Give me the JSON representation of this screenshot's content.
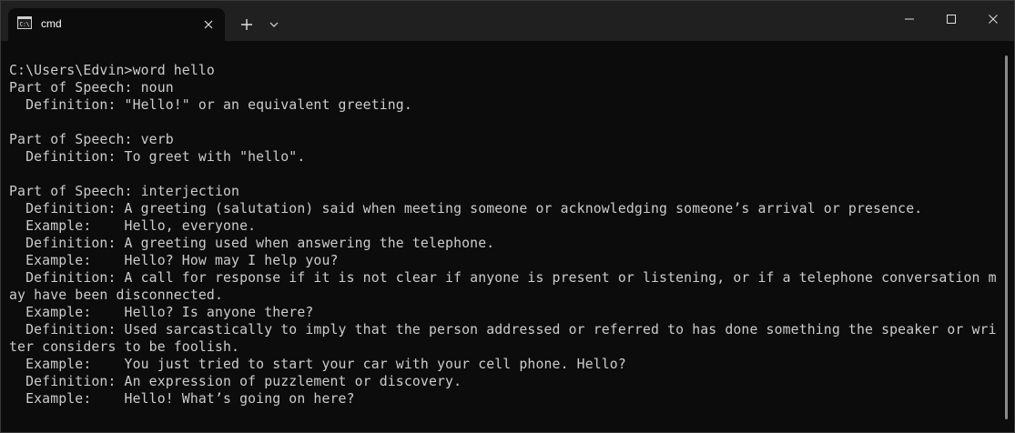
{
  "window": {
    "tab_title": "cmd",
    "colors": {
      "titlebar": "#202020",
      "terminal_bg": "#0c0c0c",
      "terminal_fg": "#cccccc",
      "scrollbar_thumb": "#8a8a8a"
    }
  },
  "icons": {
    "tab_icon": "cmd-icon",
    "tab_close": "close-icon",
    "new_tab": "plus-icon",
    "dropdown": "chevron-down-icon",
    "minimize": "minimize-icon",
    "maximize": "maximize-icon",
    "close": "close-icon"
  },
  "terminal": {
    "lines": [
      "C:\\Users\\Edvin>word hello",
      "Part of Speech: noun",
      "  Definition: \"Hello!\" or an equivalent greeting.",
      "",
      "Part of Speech: verb",
      "  Definition: To greet with \"hello\".",
      "",
      "Part of Speech: interjection",
      "  Definition: A greeting (salutation) said when meeting someone or acknowledging someone’s arrival or presence.",
      "  Example:    Hello, everyone.",
      "  Definition: A greeting used when answering the telephone.",
      "  Example:    Hello? How may I help you?",
      "  Definition: A call for response if it is not clear if anyone is present or listening, or if a telephone conversation m",
      "ay have been disconnected.",
      "  Example:    Hello? Is anyone there?",
      "  Definition: Used sarcastically to imply that the person addressed or referred to has done something the speaker or wri",
      "ter considers to be foolish.",
      "  Example:    You just tried to start your car with your cell phone. Hello?",
      "  Definition: An expression of puzzlement or discovery.",
      "  Example:    Hello! What’s going on here?"
    ]
  }
}
